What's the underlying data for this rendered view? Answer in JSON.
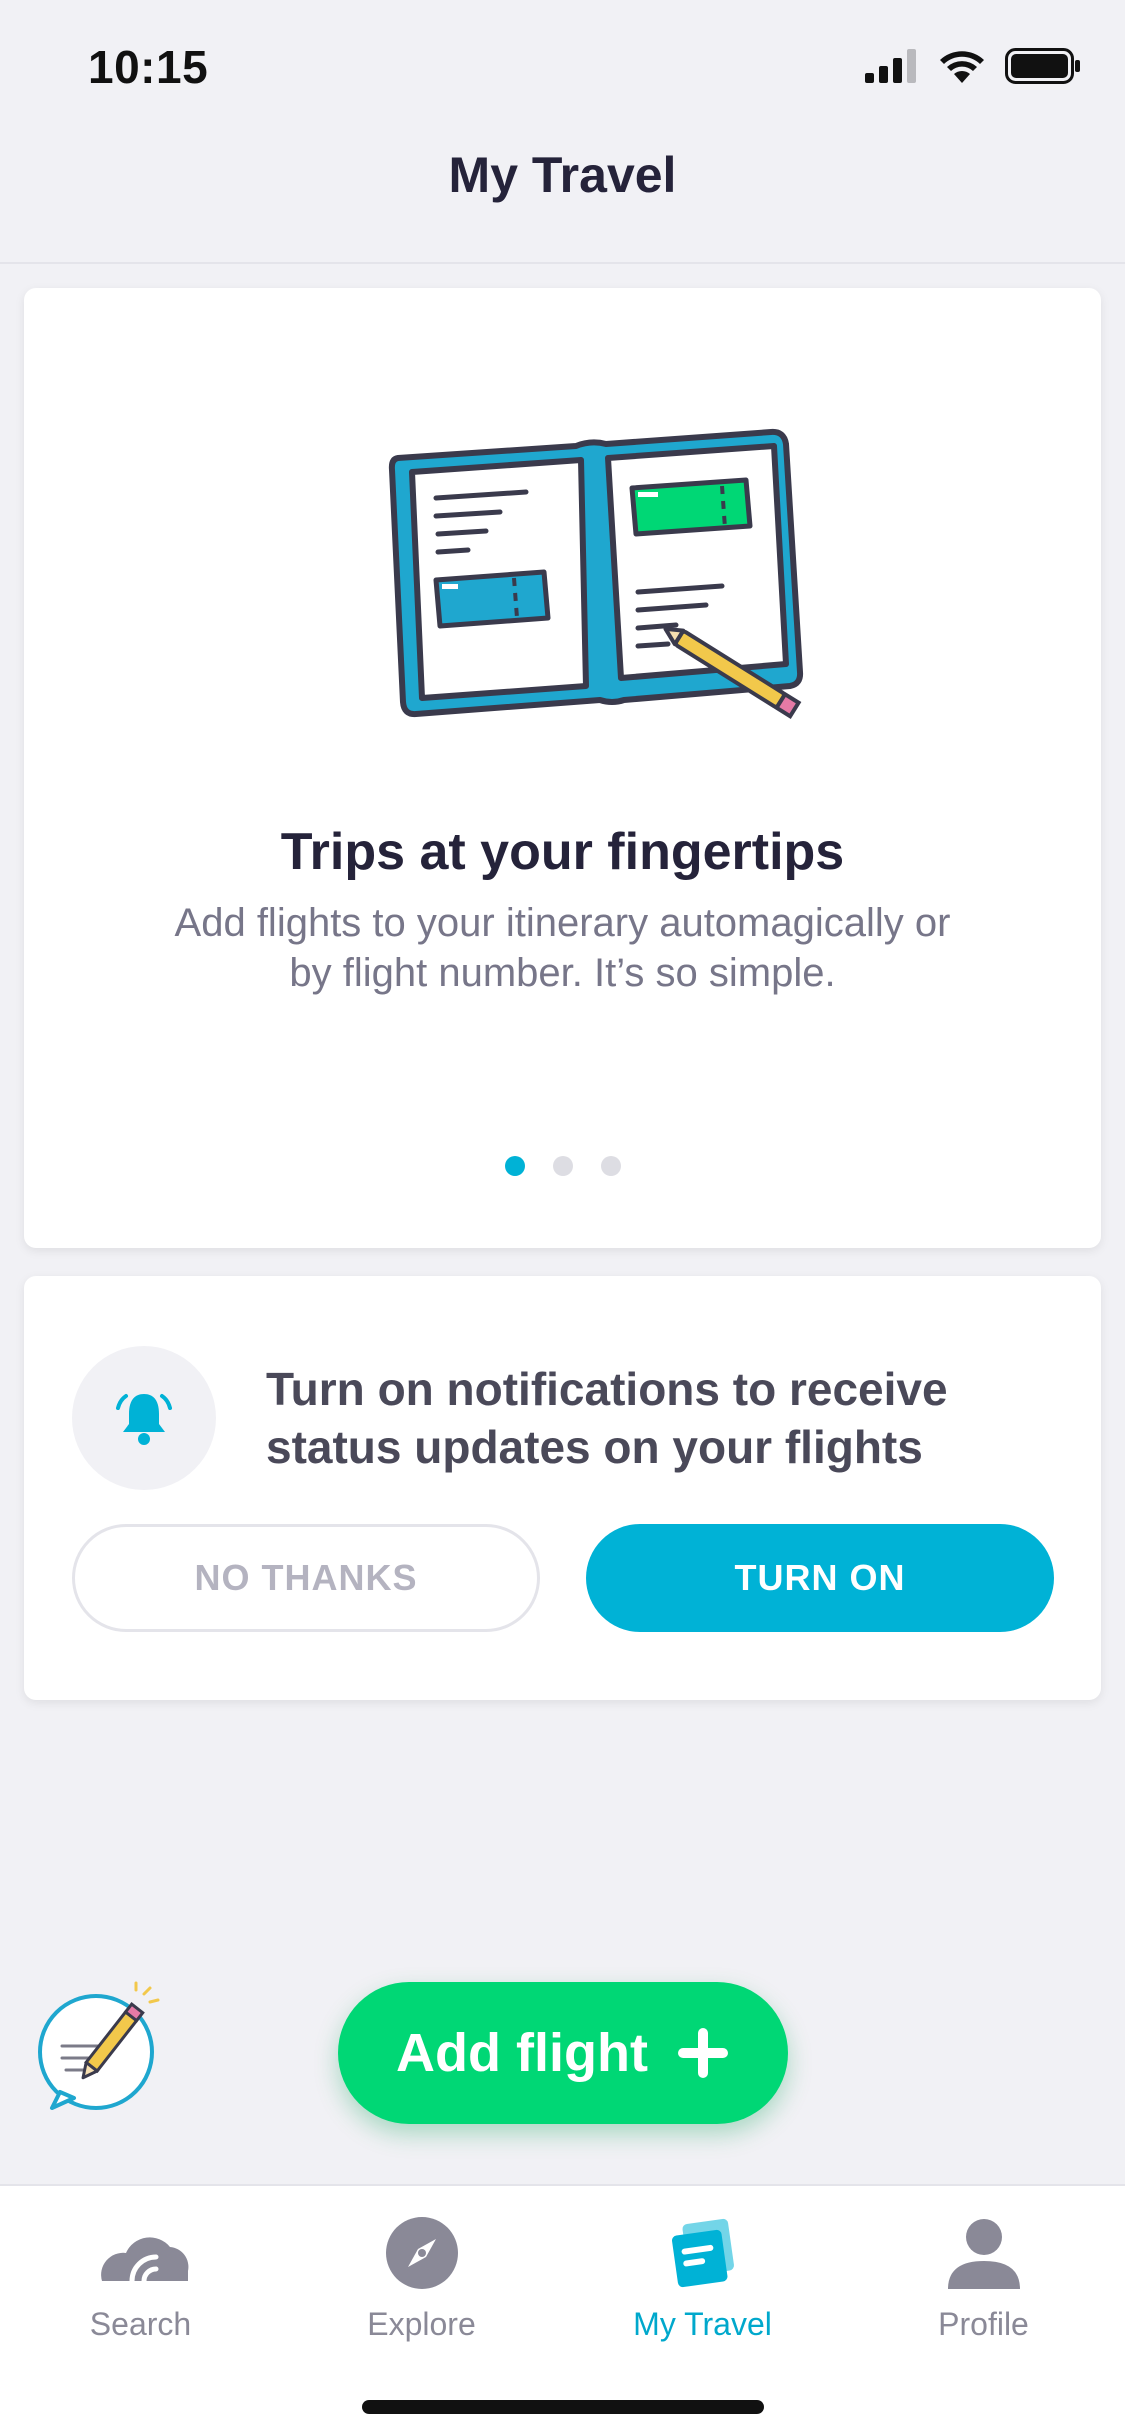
{
  "status_bar": {
    "time": "10:15"
  },
  "nav": {
    "title": "My Travel"
  },
  "hero": {
    "title": "Trips at your fingertips",
    "description": "Add flights to your itinerary automagically or by flight number. It’s so simple.",
    "page_count": 3,
    "active_page": 1
  },
  "notification": {
    "text": "Turn on notifications to receive status updates on your flights",
    "no_label": "NO THANKS",
    "yes_label": "TURN ON"
  },
  "add_flight": {
    "label": "Add flight"
  },
  "tabs": [
    {
      "label": "Search",
      "icon": "search-cloud-icon",
      "active": false
    },
    {
      "label": "Explore",
      "icon": "compass-icon",
      "active": false
    },
    {
      "label": "My Travel",
      "icon": "my-travel-icon",
      "active": true
    },
    {
      "label": "Profile",
      "icon": "profile-icon",
      "active": false
    }
  ],
  "colors": {
    "accent": "#00b2d6",
    "add_flight": "#00d775",
    "ticket_green": "#00d775",
    "title_text": "#25233a",
    "muted_text": "#777689"
  }
}
